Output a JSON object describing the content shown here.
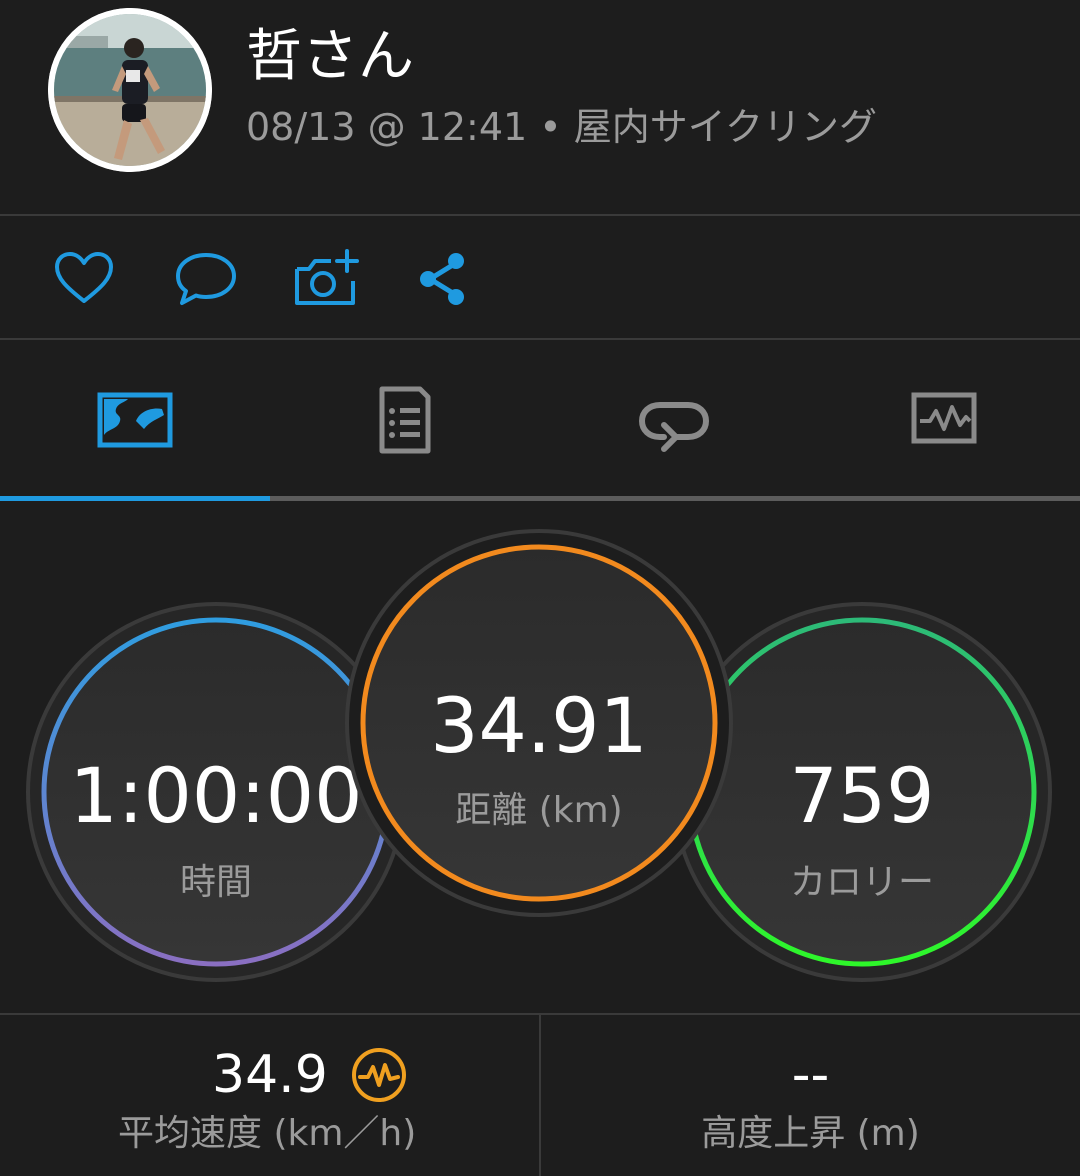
{
  "header": {
    "user_name": "哲さん",
    "date_time": "08/13 @ 12:41",
    "separator": " • ",
    "activity_type": "屋内サイクリング"
  },
  "actions": [
    {
      "name": "like",
      "icon": "heart-icon"
    },
    {
      "name": "comment",
      "icon": "comment-bubble-icon"
    },
    {
      "name": "add-photo",
      "icon": "camera-plus-icon"
    },
    {
      "name": "share",
      "icon": "share-icon"
    }
  ],
  "tabs": [
    {
      "name": "overview",
      "icon": "map-overview-icon",
      "selected": true
    },
    {
      "name": "stats",
      "icon": "document-list-icon",
      "selected": false
    },
    {
      "name": "laps",
      "icon": "loop-arrow-icon",
      "selected": false
    },
    {
      "name": "charts",
      "icon": "chart-pulse-icon",
      "selected": false
    }
  ],
  "stats": {
    "time": {
      "value": "1:00:00",
      "label": "時間"
    },
    "distance": {
      "value": "34.91",
      "label": "距離 (km)"
    },
    "calories": {
      "value": "759",
      "label": "カロリー"
    }
  },
  "metrics": {
    "avg_speed": {
      "value": "34.9",
      "label": "平均速度 (km／h)",
      "icon": "pulse-badge-icon"
    },
    "elevation_gain": {
      "value": "--",
      "label": "高度上昇 (m)"
    }
  },
  "colors": {
    "accent": "#1f9ae0",
    "time_ring_top": "#2f9de0",
    "time_ring_bottom": "#8a6fc2",
    "distance_ring": "#f28a1e",
    "calories_ring_top": "#2dba78",
    "calories_ring_bottom": "#2ef72a",
    "badge_orange": "#f0a020"
  }
}
